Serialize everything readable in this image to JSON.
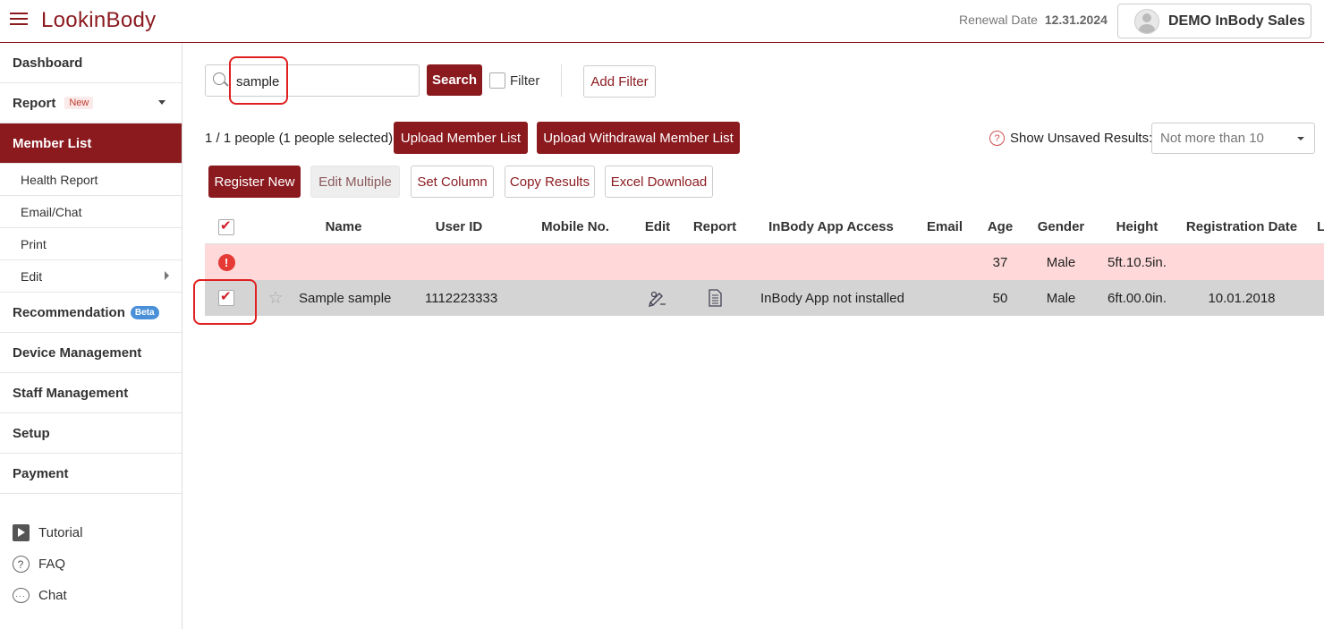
{
  "header": {
    "logo": "LookinBody",
    "renewal_label": "Renewal Date",
    "renewal_date": "12.31.2024",
    "user_name": "DEMO InBody Sales"
  },
  "sidebar": {
    "dashboard": "Dashboard",
    "report": "Report",
    "report_badge": "New",
    "member_list": "Member List",
    "sub_items": [
      "Health Report",
      "Email/Chat",
      "Print",
      "Edit"
    ],
    "recommendation": "Recommendation",
    "recommendation_badge": "Beta",
    "device_management": "Device Management",
    "staff_management": "Staff Management",
    "setup": "Setup",
    "payment": "Payment",
    "bottom_links": [
      "Tutorial",
      "FAQ",
      "Chat"
    ]
  },
  "toolbar": {
    "search_value": "sample",
    "search_button": "Search",
    "filter_label": "Filter",
    "add_filter": "Add Filter",
    "count_text": "1 / 1 people (1 people selected)",
    "upload_member_list": "Upload Member List",
    "upload_withdrawal": "Upload Withdrawal Member List",
    "show_unsaved_label": "Show Unsaved Results:",
    "show_unsaved_value": "Not more than 10",
    "register_new": "Register New",
    "edit_multiple": "Edit Multiple",
    "set_column": "Set Column",
    "copy_results": "Copy Results",
    "excel_download": "Excel Download"
  },
  "table": {
    "columns": {
      "name": "Name",
      "user_id": "User ID",
      "mobile": "Mobile No.",
      "edit": "Edit",
      "report": "Report",
      "app_access": "InBody App Access",
      "email": "Email",
      "age": "Age",
      "gender": "Gender",
      "height": "Height",
      "reg_date": "Registration Date",
      "overflow": "L"
    },
    "warning_row": {
      "age": "37",
      "gender": "Male",
      "height": "5ft.10.5in."
    },
    "member_row": {
      "name": "Sample sample",
      "user_id": "1112223333",
      "app_access": "InBody App not installed",
      "age": "50",
      "gender": "Male",
      "height": "6ft.00.0in.",
      "reg_date": "10.01.2018"
    }
  },
  "colors": {
    "brand": "#8b1a1f",
    "highlight": "#e02020",
    "warning_row": "#ffd9d9",
    "selected_row": "#d4d4d4"
  },
  "icons": [
    "menu-icon",
    "avatar-icon",
    "search-icon",
    "alert-icon",
    "star-icon",
    "edit-pen-icon",
    "report-doc-icon",
    "play-icon",
    "question-icon",
    "chat-bubble-icon"
  ]
}
